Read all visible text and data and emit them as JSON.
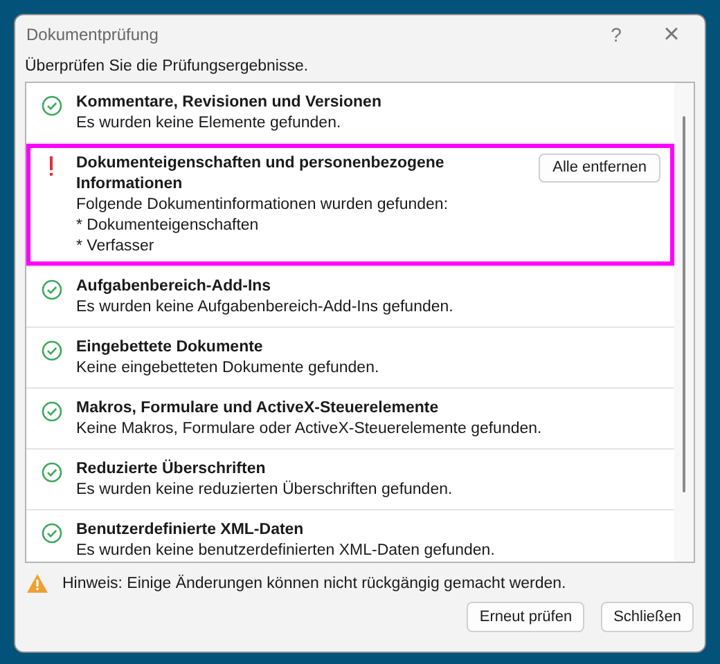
{
  "window": {
    "title": "Dokumentprüfung",
    "help": "?",
    "close": "×"
  },
  "intro": "Überprüfen Sie die Prüfungsergebnisse.",
  "results": [
    {
      "kind": "ok",
      "title": "Kommentare, Revisionen und Versionen",
      "lines": [
        "Es wurden keine Elemente gefunden."
      ],
      "highlighted": false
    },
    {
      "kind": "issue",
      "title": "Dokumenteigenschaften und personenbezogene Informationen",
      "lines": [
        "Folgende Dokumentinformationen wurden gefunden:",
        "* Dokumenteigenschaften",
        "* Verfasser"
      ],
      "button": "Alle entfernen",
      "highlighted": true
    },
    {
      "kind": "ok",
      "title": "Aufgabenbereich-Add-Ins",
      "lines": [
        "Es wurden keine Aufgabenbereich-Add-Ins gefunden."
      ],
      "highlighted": false
    },
    {
      "kind": "ok",
      "title": "Eingebettete Dokumente",
      "lines": [
        "Keine eingebetteten Dokumente gefunden."
      ],
      "highlighted": false
    },
    {
      "kind": "ok",
      "title": "Makros, Formulare und ActiveX-Steuerelemente",
      "lines": [
        "Keine Makros, Formulare oder ActiveX-Steuerelemente gefunden."
      ],
      "highlighted": false
    },
    {
      "kind": "ok",
      "title": "Reduzierte Überschriften",
      "lines": [
        "Es wurden keine reduzierten Überschriften gefunden."
      ],
      "highlighted": false
    },
    {
      "kind": "ok",
      "title": "Benutzerdefinierte XML-Daten",
      "lines": [
        "Es wurden keine benutzerdefinierten XML-Daten gefunden."
      ],
      "highlighted": false
    }
  ],
  "hint": "Hinweis: Einige Änderungen können nicht rückgängig gemacht werden.",
  "buttons": [
    {
      "label": "Erneut prüfen"
    },
    {
      "label": "Schließen"
    }
  ]
}
